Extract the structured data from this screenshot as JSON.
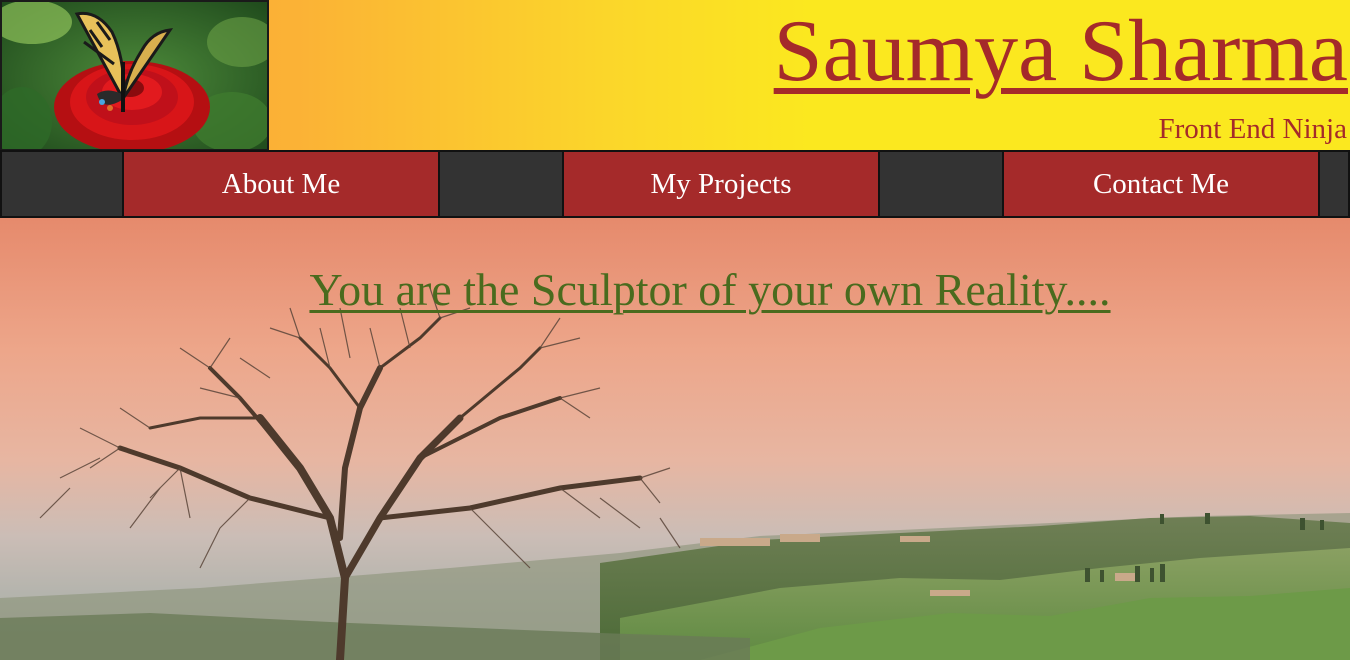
{
  "header": {
    "title": "Saumya Sharma",
    "tagline": "Front End Ninja",
    "logo_icon": "butterfly-on-red-flower-image"
  },
  "nav": {
    "items": [
      {
        "label": "About Me"
      },
      {
        "label": "My Projects"
      },
      {
        "label": "Contact Me"
      }
    ]
  },
  "hero": {
    "quote": "You are the Sculptor of your own Reality....",
    "image": "tuscan-landscape-with-bare-tree"
  },
  "colors": {
    "header_gradient_start": "#faa83c",
    "header_gradient_end": "#fbe81f",
    "title": "#a52a2a",
    "nav_bg": "#333333",
    "nav_item_bg": "#a52a2a",
    "quote": "#4a6b1e"
  }
}
